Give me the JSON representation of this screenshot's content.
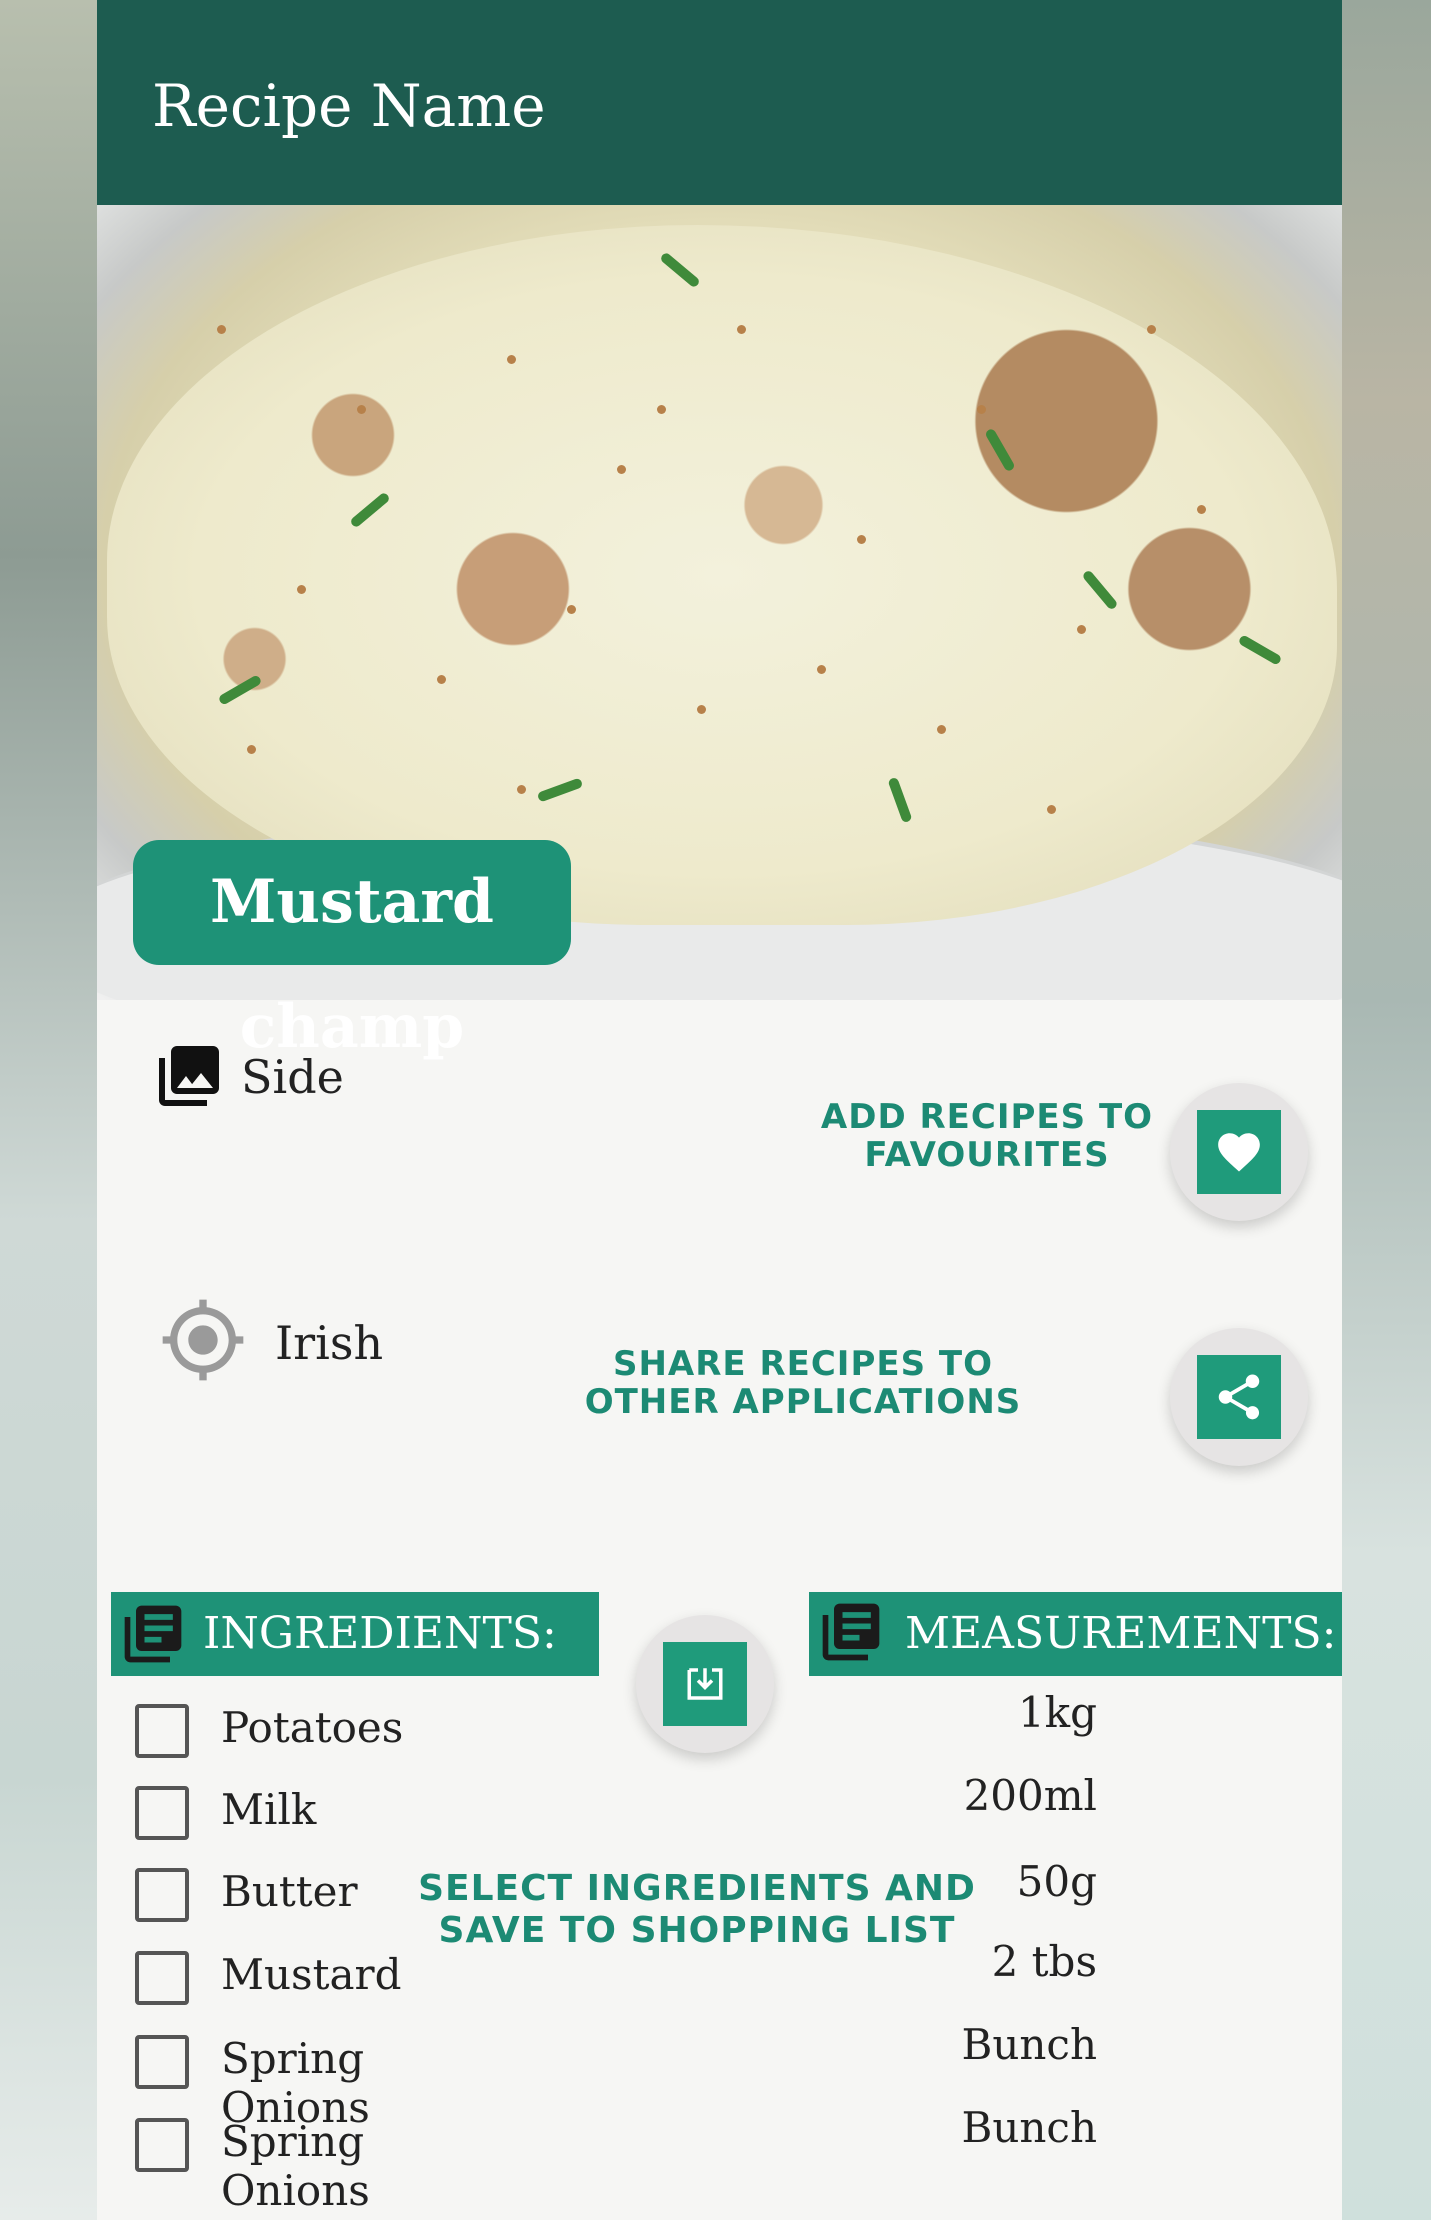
{
  "appbar": {
    "title": "Recipe Name"
  },
  "recipe": {
    "name": "Mustard champ",
    "category": "Side",
    "area": "Irish"
  },
  "hints": {
    "favourites_line1": "ADD RECIPES TO",
    "favourites_line2": "FAVOURITES",
    "share_line1": "SHARE RECIPES TO",
    "share_line2": "OTHER APPLICATIONS",
    "select_line1": "SELECT INGREDIENTS AND",
    "select_line2": "SAVE TO SHOPPING LIST"
  },
  "ingredients": {
    "header": "INGREDIENTS:",
    "items": [
      "Potatoes",
      "Milk",
      "Butter",
      "Mustard",
      "Spring Onions",
      "Spring Onions"
    ]
  },
  "measurements": {
    "header": "MEASUREMENTS:",
    "items": [
      "1kg",
      "200ml",
      "50g",
      "2 tbs",
      "Bunch",
      "Bunch"
    ]
  },
  "icons": {
    "category": "gallery-icon",
    "area": "crosshair-icon",
    "favourite": "heart-icon",
    "share": "share-icon",
    "save": "download-icon",
    "list": "list-icon"
  },
  "colors": {
    "appbar": "#1d5c50",
    "accent": "#1e9277",
    "hint_text": "#1c8a74"
  }
}
